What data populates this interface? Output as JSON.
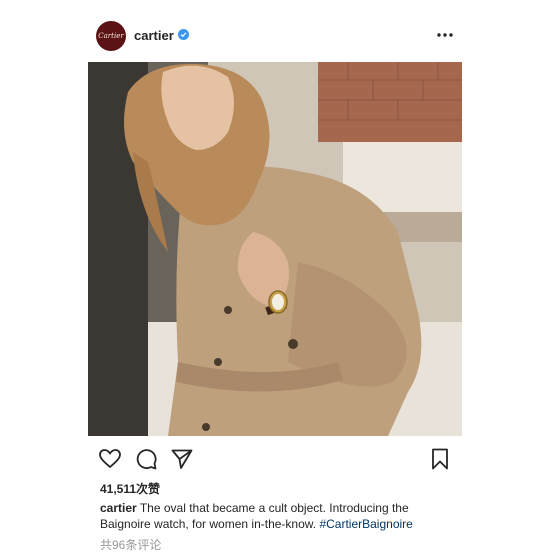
{
  "post": {
    "username": "cartier",
    "avatar_text": "Cartier",
    "verified_icon": "verified-badge-icon",
    "more_icon": "more-options-icon",
    "image_alt": "model in trench coat wearing Baignoire watch",
    "actions": {
      "like_icon": "heart-icon",
      "comment_icon": "comment-bubble-icon",
      "share_icon": "paper-plane-icon",
      "save_icon": "bookmark-icon"
    },
    "likes_text": "41,511次赞",
    "caption": {
      "username": "cartier",
      "text": "The oval that became a cult object. Introducing the Baignoire watch, for women in-the-know.",
      "hashtag": "#CartierBaignoire"
    },
    "comments_text": "共96条评论",
    "colors": {
      "avatar_bg": "#5b1316",
      "verified": "#3897f0",
      "hashtag": "#003569",
      "muted": "#999999"
    }
  }
}
